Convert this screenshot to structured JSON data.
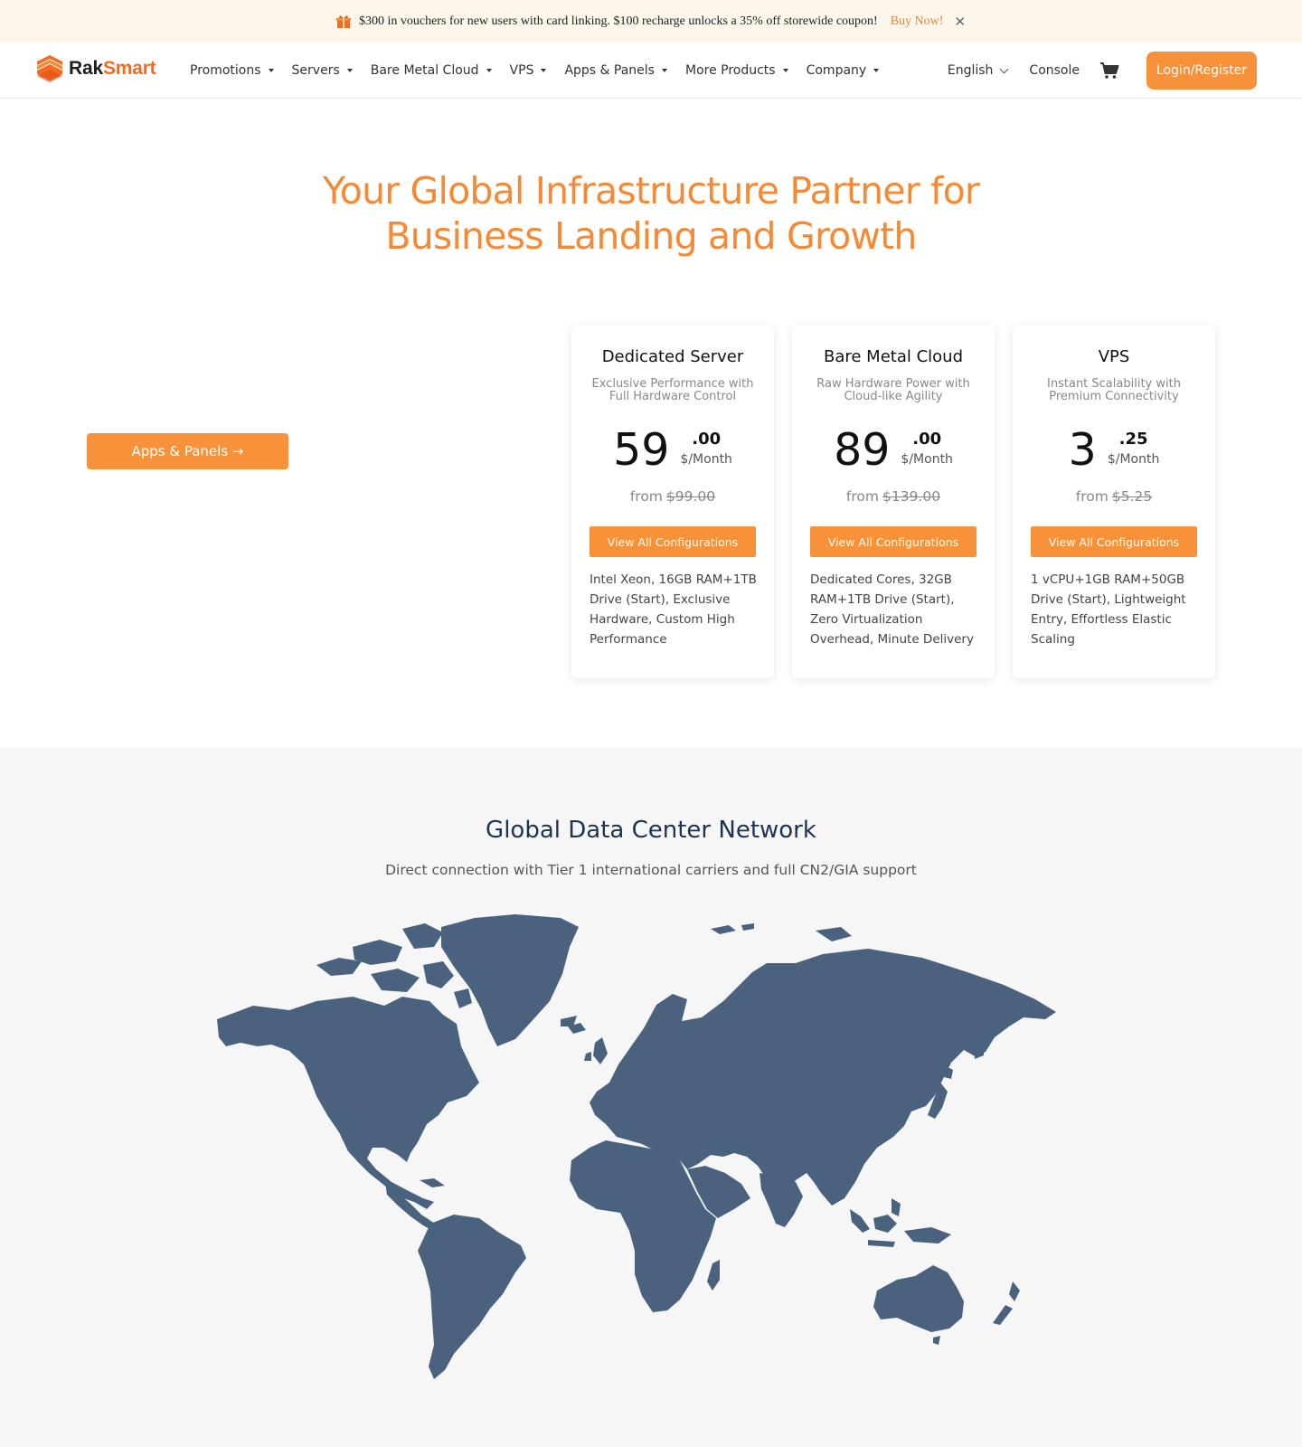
{
  "promo": {
    "icon": "gift-icon",
    "text": "$300 in vouchers for new users with card linking. $100 recharge unlocks a 35% off storewide coupon!",
    "cta": "Buy Now!",
    "close": "✕"
  },
  "nav": {
    "logo_rak": "Rak",
    "logo_smart": "Smart",
    "menu": [
      {
        "label": "Promotions"
      },
      {
        "label": "Servers"
      },
      {
        "label": "Bare Metal Cloud"
      },
      {
        "label": "VPS"
      },
      {
        "label": "Apps & Panels"
      },
      {
        "label": "More Products"
      },
      {
        "label": "Company"
      }
    ],
    "language": "English",
    "console": "Console",
    "cart_icon": "cart-icon",
    "login": "Login/Register"
  },
  "hero": {
    "title_line1": "Your Global Infrastructure Partner for",
    "title_line2": "Business Landing and Growth",
    "apps_button": "Apps & Panels →"
  },
  "cards": [
    {
      "title": "Dedicated Server",
      "subtitle": "Exclusive Performance with Full Hardware Control",
      "price_int": "59",
      "price_dec": ".00",
      "unit": "$/Month",
      "from_label": "from",
      "old_price": "$99.00",
      "button": "View All Configurations",
      "desc": "Intel Xeon, 16GB RAM+1TB Drive (Start), Exclusive Hardware, Custom High Performance"
    },
    {
      "title": "Bare Metal Cloud",
      "subtitle": "Raw Hardware Power with Cloud-like Agility",
      "price_int": "89",
      "price_dec": ".00",
      "unit": "$/Month",
      "from_label": "from",
      "old_price": "$139.00",
      "button": "View All Configurations",
      "desc": "Dedicated Cores, 32GB RAM+1TB Drive (Start), Zero Virtualization Overhead, Minute Delivery"
    },
    {
      "title": "VPS",
      "subtitle": "Instant Scalability with Premium Connectivity",
      "price_int": "3",
      "price_dec": ".25",
      "unit": "$/Month",
      "from_label": "from",
      "old_price": "$5.25",
      "button": "View All Configurations",
      "desc": "1 vCPU+1GB RAM+50GB Drive (Start), Lightweight Entry, Effortless Elastic Scaling"
    }
  ],
  "network": {
    "title": "Global Data Center Network",
    "subtitle": "Direct connection with Tier 1 international carriers and full CN2/GIA support",
    "map_icon": "world-map"
  },
  "colors": {
    "accent": "#f7923a",
    "brand": "#f26b21",
    "map": "#4a627e",
    "network_title": "#1d3350",
    "promo_bg": "#fdf6ea"
  }
}
